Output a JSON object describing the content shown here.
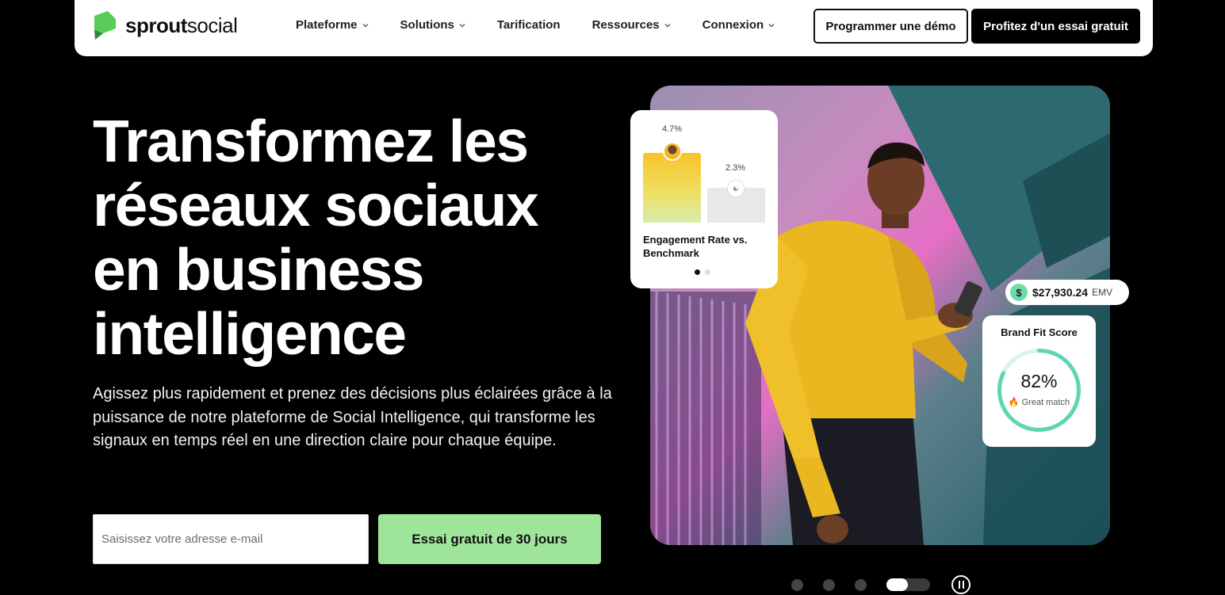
{
  "brand": {
    "bold": "sprout",
    "light": "social",
    "color": "#59cb59"
  },
  "nav": {
    "items": [
      {
        "label": "Plateforme",
        "dropdown": true
      },
      {
        "label": "Solutions",
        "dropdown": true
      },
      {
        "label": "Tarification",
        "dropdown": false
      },
      {
        "label": "Ressources",
        "dropdown": true
      },
      {
        "label": "Connexion",
        "dropdown": true
      }
    ],
    "demo_label": "Programmer une démo",
    "trial_label": "Profitez d'un essai gratuit"
  },
  "hero": {
    "title": "Transformez les réseaux sociaux en business intelligence",
    "subtitle": "Agissez plus rapidement et prenez des décisions plus éclairées grâce à la puissance de notre plateforme de Social Intelligence, qui transforme les signaux en temps réel en une direction claire pour chaque équipe.",
    "email_placeholder": "Saisissez votre adresse e-mail",
    "cta_label": "Essai gratuit de 30 jours",
    "cta_color": "#9ee59a"
  },
  "engagement_card": {
    "brand_value": "4.7%",
    "benchmark_value": "2.3%",
    "title": "Engagement Rate vs. Benchmark",
    "page_count": 2,
    "active_page": 1
  },
  "emv_badge": {
    "icon": "$",
    "value": "$27,930.24",
    "unit": "EMV"
  },
  "brand_fit": {
    "title": "Brand Fit Score",
    "percent": "82%",
    "match_icon": "🔥",
    "match_label": "Great match",
    "fill": 0.82
  },
  "carousel": {
    "slides": 4,
    "active": 4
  }
}
